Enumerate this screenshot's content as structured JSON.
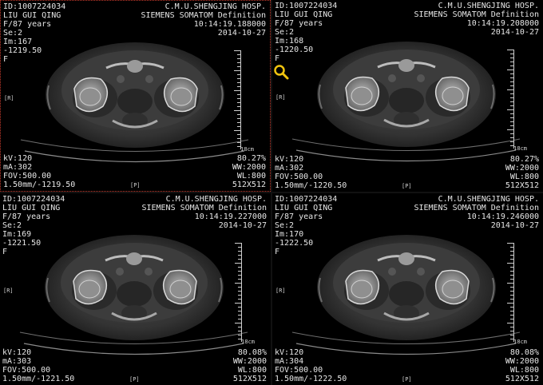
{
  "viewports": [
    {
      "id": "ID:1007224034",
      "name": "LIU GUI QING",
      "sex_age": "F/87 years",
      "series": "Se:2",
      "image": "Im:167",
      "position": "-1219.50",
      "orientation_left": "F",
      "hospital": "C.M.U.SHENGJING HOSP.",
      "scanner": "SIEMENS SOMATOM Definition",
      "time": "10:14:19.188000",
      "date": "2014-10-27",
      "kv": "kV:120",
      "ma": "mA:302",
      "fov": "FOV:500.00",
      "slice": "1.50mm/-1219.50",
      "zoom": "80.27%",
      "ww": "WW:2000",
      "wl": "WL:800",
      "matrix": "512X512",
      "marker_r": "[R]",
      "marker_p": "[P]",
      "scale": "18cm",
      "active": true
    },
    {
      "id": "ID:1007224034",
      "name": "LIU GUI QING",
      "sex_age": "F/87 years",
      "series": "Se:2",
      "image": "Im:168",
      "position": "-1220.50",
      "orientation_left": "F",
      "hospital": "C.M.U.SHENGJING HOSP.",
      "scanner": "SIEMENS SOMATOM Definition",
      "time": "10:14:19.208000",
      "date": "2014-10-27",
      "kv": "kV:120",
      "ma": "mA:302",
      "fov": "FOV:500.00",
      "slice": "1.50mm/-1220.50",
      "zoom": "80.27%",
      "ww": "WW:2000",
      "wl": "WL:800",
      "matrix": "512X512",
      "marker_r": "[R]",
      "marker_p": "[P]",
      "scale": "18cm",
      "active": false
    },
    {
      "id": "ID:1007224034",
      "name": "LIU GUI QING",
      "sex_age": "F/87 years",
      "series": "Se:2",
      "image": "Im:169",
      "position": "-1221.50",
      "orientation_left": "F",
      "hospital": "C.M.U.SHENGJING HOSP.",
      "scanner": "SIEMENS SOMATOM Definition",
      "time": "10:14:19.227000",
      "date": "2014-10-27",
      "kv": "kV:120",
      "ma": "mA:303",
      "fov": "FOV:500.00",
      "slice": "1.50mm/-1221.50",
      "zoom": "80.08%",
      "ww": "WW:2000",
      "wl": "WL:800",
      "matrix": "512X512",
      "marker_r": "[R]",
      "marker_p": "[P]",
      "scale": "18cm",
      "active": false
    },
    {
      "id": "ID:1007224034",
      "name": "LIU GUI QING",
      "sex_age": "F/87 years",
      "series": "Se:2",
      "image": "Im:170",
      "position": "-1222.50",
      "orientation_left": "F",
      "hospital": "C.M.U.SHENGJING HOSP.",
      "scanner": "SIEMENS SOMATOM Definition",
      "time": "10:14:19.246000",
      "date": "2014-10-27",
      "kv": "kV:120",
      "ma": "mA:304",
      "fov": "FOV:500.00",
      "slice": "1.50mm/-1222.50",
      "zoom": "80.08%",
      "ww": "WW:2000",
      "wl": "WL:800",
      "matrix": "512X512",
      "marker_r": "[R]",
      "marker_p": "[P]",
      "scale": "18cm",
      "active": false
    }
  ],
  "cursor_icon": "magnifier-cursor-icon",
  "colors": {
    "active_border": "#c0392b",
    "cursor": "#f1c40f"
  }
}
